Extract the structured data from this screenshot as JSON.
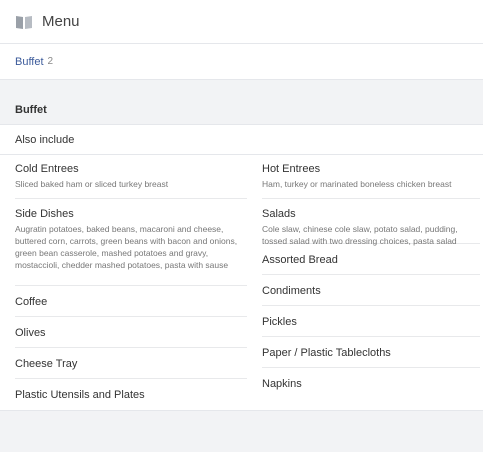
{
  "header": {
    "title": "Menu",
    "icon": "menu-book-icon"
  },
  "tabs": [
    {
      "label": "Buffet",
      "count": "2"
    }
  ],
  "section": {
    "title": "Buffet",
    "subheader": "Also include",
    "left_items": [
      {
        "name": "Cold Entrees",
        "desc": "Sliced baked ham or sliced turkey breast"
      },
      {
        "name": "Side Dishes",
        "desc": "Augratin potatoes, baked beans, macaroni and cheese, buttered corn, carrots, green beans with bacon and onions, green bean casserole, mashed potatoes and gravy, mostaccioli, chedder mashed potatoes, pasta with sause"
      },
      {
        "name": "Coffee",
        "desc": ""
      },
      {
        "name": "Olives",
        "desc": ""
      },
      {
        "name": "Cheese Tray",
        "desc": ""
      },
      {
        "name": "Plastic Utensils and Plates",
        "desc": ""
      }
    ],
    "right_items": [
      {
        "name": "Hot Entrees",
        "desc": "Ham, turkey or marinated boneless chicken breast"
      },
      {
        "name": "Salads",
        "desc": "Cole slaw, chinese cole slaw, potato salad, pudding, tossed salad with two dressing choices, pasta salad"
      },
      {
        "name": "Assorted Bread",
        "desc": ""
      },
      {
        "name": "Condiments",
        "desc": ""
      },
      {
        "name": "Pickles",
        "desc": ""
      },
      {
        "name": "Paper / Plastic Tablecloths",
        "desc": ""
      },
      {
        "name": "Napkins",
        "desc": ""
      }
    ]
  }
}
